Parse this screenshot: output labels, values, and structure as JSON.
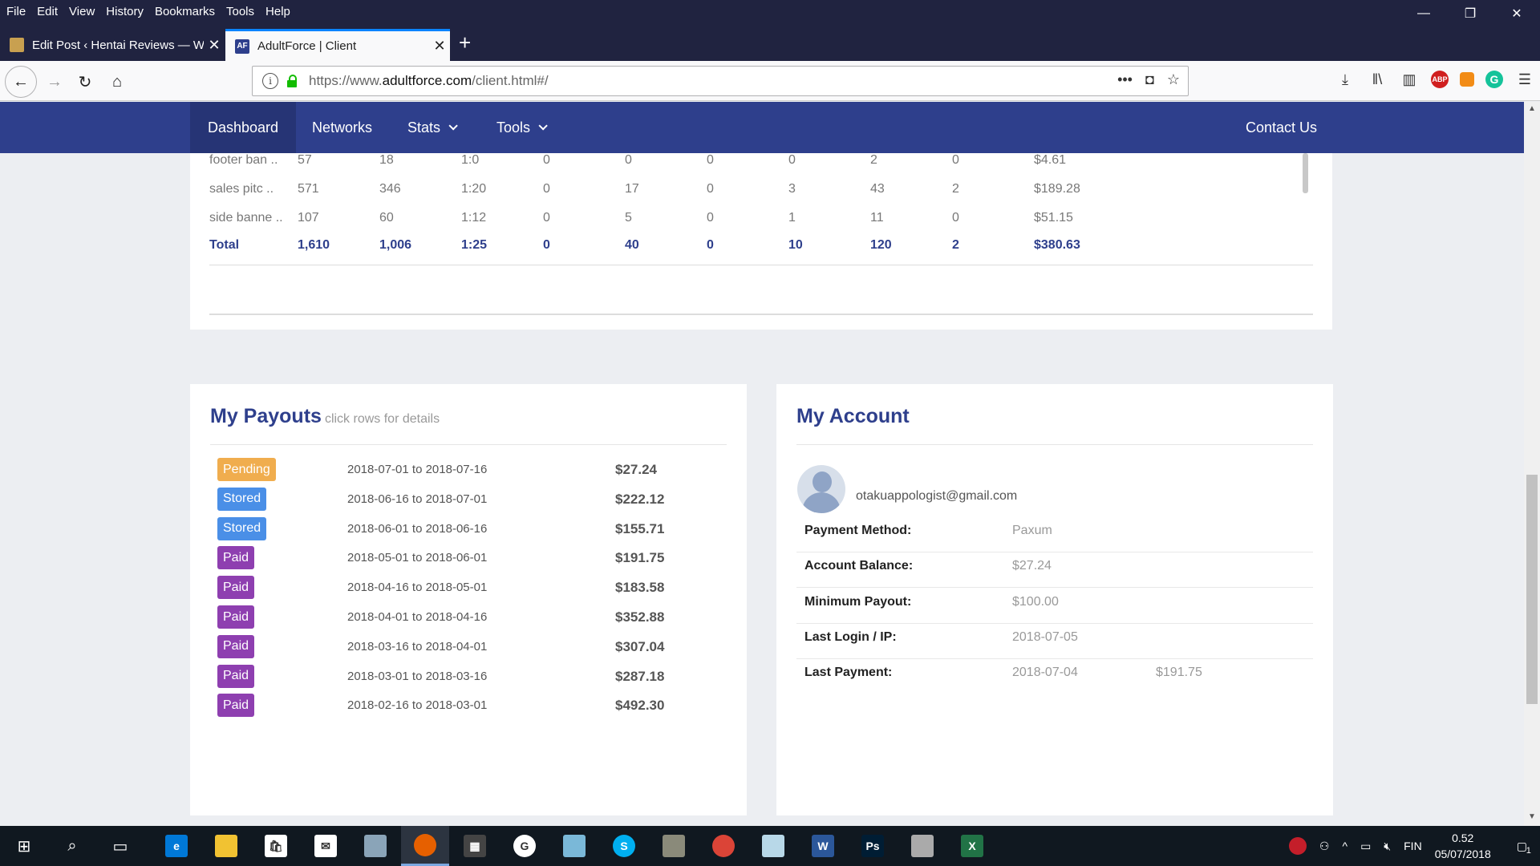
{
  "menubar": {
    "items": [
      "File",
      "Edit",
      "View",
      "History",
      "Bookmarks",
      "Tools",
      "Help"
    ]
  },
  "tabs": [
    {
      "title": "Edit Post ‹ Hentai Reviews — W",
      "favicon_color": "#c8a050"
    },
    {
      "title": "AdultForce | Client",
      "favicon_color": "#2e3f8c"
    }
  ],
  "address_bar": {
    "url_prefix": "https://www.",
    "url_domain": "adultforce.com",
    "url_path": "/client.html#/"
  },
  "site_nav": {
    "dashboard": "Dashboard",
    "networks": "Networks",
    "stats": "Stats",
    "tools": "Tools",
    "contact": "Contact Us"
  },
  "stats_table": {
    "rows": [
      [
        "footer ban ..",
        "57",
        "18",
        "1:0",
        "0",
        "0",
        "0",
        "0",
        "2",
        "0",
        "$4.61"
      ],
      [
        "sales pitc ..",
        "571",
        "346",
        "1:20",
        "0",
        "17",
        "0",
        "3",
        "43",
        "2",
        "$189.28"
      ],
      [
        "side banne ..",
        "107",
        "60",
        "1:12",
        "0",
        "5",
        "0",
        "1",
        "11",
        "0",
        "$51.15"
      ]
    ],
    "total": [
      "Total",
      "1,610",
      "1,006",
      "1:25",
      "0",
      "40",
      "0",
      "10",
      "120",
      "2",
      "$380.63"
    ]
  },
  "payouts": {
    "title": "My Payouts",
    "hint": "click rows for details",
    "rows": [
      {
        "status": "Pending",
        "color": "#f0ad4e",
        "range": "2018-07-01 to 2018-07-16",
        "amount": "$27.24"
      },
      {
        "status": "Stored",
        "color": "#4a8fe7",
        "range": "2018-06-16 to 2018-07-01",
        "amount": "$222.12"
      },
      {
        "status": "Stored",
        "color": "#4a8fe7",
        "range": "2018-06-01 to 2018-06-16",
        "amount": "$155.71"
      },
      {
        "status": "Paid",
        "color": "#8e3fb0",
        "range": "2018-05-01 to 2018-06-01",
        "amount": "$191.75"
      },
      {
        "status": "Paid",
        "color": "#8e3fb0",
        "range": "2018-04-16 to 2018-05-01",
        "amount": "$183.58"
      },
      {
        "status": "Paid",
        "color": "#8e3fb0",
        "range": "2018-04-01 to 2018-04-16",
        "amount": "$352.88"
      },
      {
        "status": "Paid",
        "color": "#8e3fb0",
        "range": "2018-03-16 to 2018-04-01",
        "amount": "$307.04"
      },
      {
        "status": "Paid",
        "color": "#8e3fb0",
        "range": "2018-03-01 to 2018-03-16",
        "amount": "$287.18"
      },
      {
        "status": "Paid",
        "color": "#8e3fb0",
        "range": "2018-02-16 to 2018-03-01",
        "amount": "$492.30"
      }
    ]
  },
  "account": {
    "title": "My Account",
    "email": "otakuappologist@gmail.com",
    "payment_method_label": "Payment Method:",
    "payment_method": "Paxum",
    "balance_label": "Account Balance:",
    "balance": "$27.24",
    "min_payout_label": "Minimum Payout:",
    "min_payout": "$100.00",
    "last_login_label": "Last Login / IP:",
    "last_login": "2018-07-05",
    "last_payment_label": "Last Payment:",
    "last_payment_date": "2018-07-04",
    "last_payment_amount": "$191.75"
  },
  "taskbar": {
    "language": "FIN",
    "time": "0.52",
    "date": "05/07/2018",
    "notification_count": "1",
    "icons": [
      "edge-icon",
      "file-explorer-icon",
      "store-icon",
      "mail-icon",
      "notepad-icon",
      "firefox-icon",
      "calculator-icon",
      "sync-icon",
      "sketch-icon",
      "skype-icon",
      "gimp-icon",
      "chrome-icon",
      "paint-icon",
      "word-icon",
      "photoshop-icon",
      "scanner-icon",
      "excel-icon"
    ]
  },
  "colors": {
    "brand": "#2e3f8c",
    "pending": "#f0ad4e",
    "stored": "#4a8fe7",
    "paid": "#8e3fb0"
  }
}
